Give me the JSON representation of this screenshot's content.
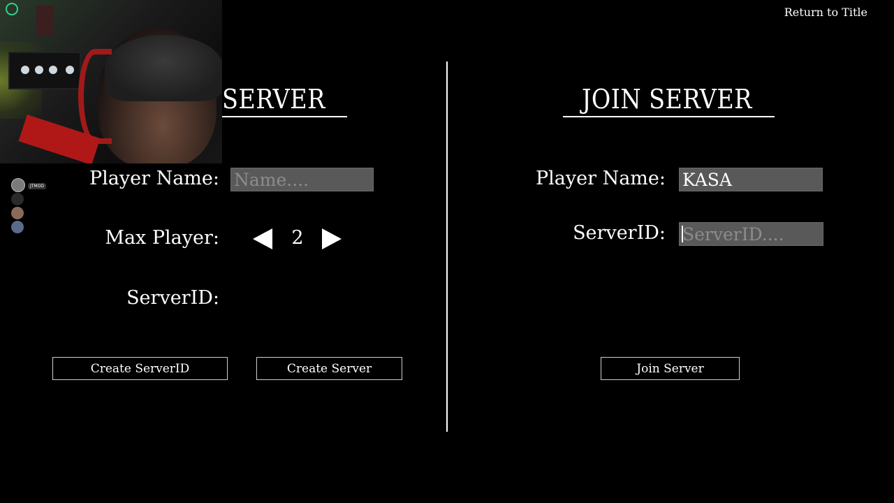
{
  "header": {
    "return_label": "Return to Title"
  },
  "create_panel": {
    "title_visible": "SERVER",
    "player_name_label": "Player Name:",
    "player_name_placeholder": "Name....",
    "player_name_value": "",
    "max_player_label": "Max Player:",
    "max_player_value": "2",
    "server_id_label": "ServerID:",
    "create_server_id_button": "Create ServerID",
    "create_server_button": "Create Server"
  },
  "join_panel": {
    "title": "JOIN SERVER",
    "player_name_label": "Player Name:",
    "player_name_value": "KASA",
    "server_id_label": "ServerID:",
    "server_id_placeholder": "ServerID....",
    "server_id_value": "",
    "join_server_button": "Join Server"
  },
  "overlay": {
    "voice_chat_user": "JTMOD"
  },
  "colors": {
    "background": "#000000",
    "text": "#ffffff",
    "input_bg": "#595959",
    "placeholder": "#8c8c8c",
    "webcam_headphone": "#a11a1a"
  },
  "icons": [
    "arrow-left-icon",
    "arrow-right-icon"
  ]
}
